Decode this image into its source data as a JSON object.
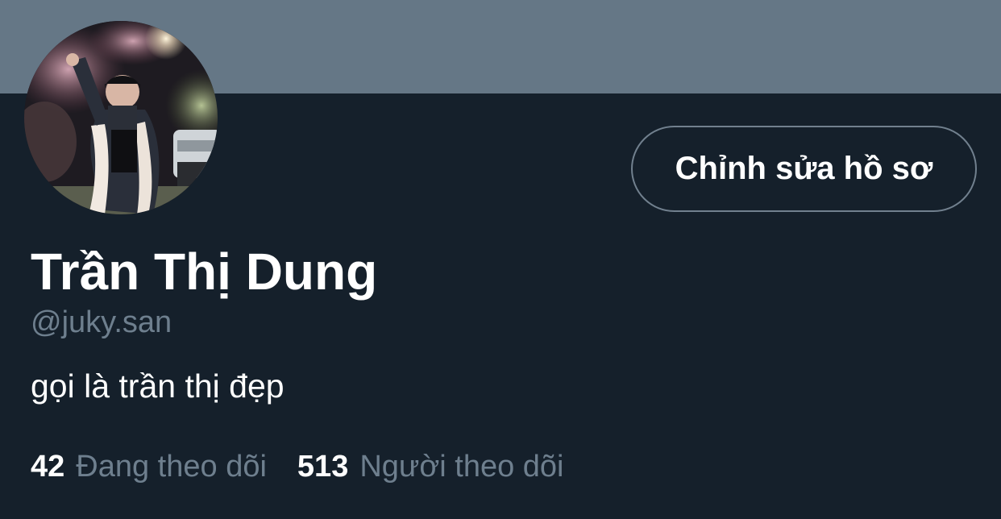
{
  "profile": {
    "display_name": "Trần Thị Dung",
    "handle": "@juky.san",
    "bio": "gọi là trần thị đẹp",
    "edit_button_label": "Chỉnh sửa hồ sơ"
  },
  "stats": {
    "following_count": "42",
    "following_label": "Đang theo dõi",
    "followers_count": "513",
    "followers_label": "Người theo dõi"
  },
  "colors": {
    "banner": "#657786",
    "background": "#15202b",
    "primary_text": "#ffffff",
    "secondary_text": "#6e7f8e",
    "button_border": "#71808e"
  }
}
